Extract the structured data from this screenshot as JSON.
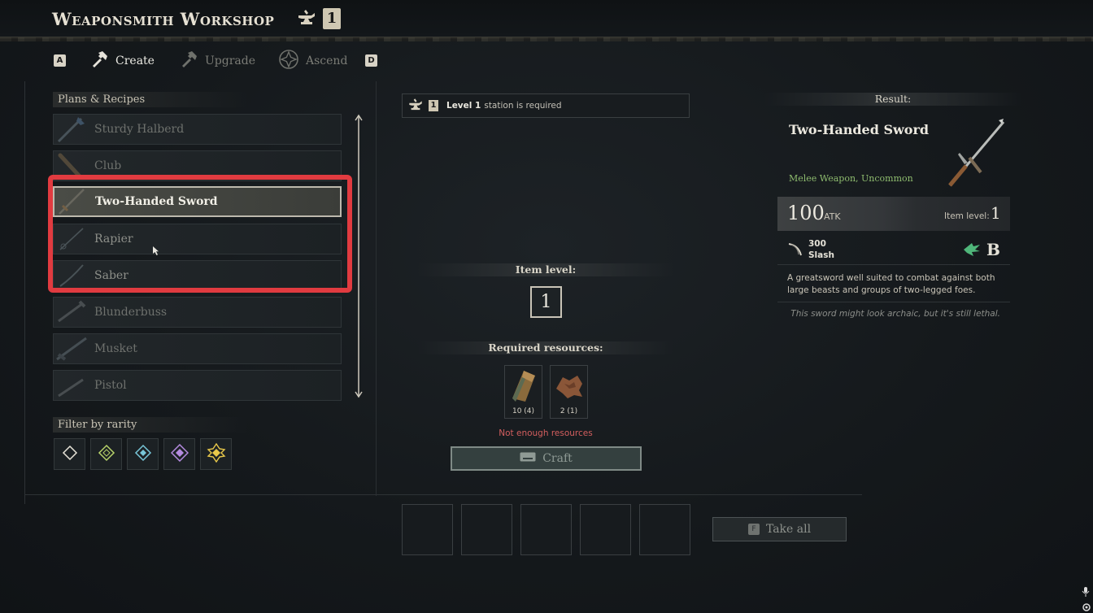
{
  "header": {
    "title": "Weaponsmith Workshop",
    "station_level": "1"
  },
  "tabs": {
    "prev_key": "A",
    "next_key": "D",
    "items": [
      {
        "label": "Create",
        "active": true
      },
      {
        "label": "Upgrade",
        "active": false
      },
      {
        "label": "Ascend",
        "active": false
      }
    ]
  },
  "plans": {
    "label": "Plans & Recipes",
    "items": [
      {
        "name": "Sturdy Halberd"
      },
      {
        "name": "Club"
      },
      {
        "name": "Two-Handed Sword",
        "selected": true
      },
      {
        "name": "Rapier"
      },
      {
        "name": "Saber"
      },
      {
        "name": "Blunderbuss"
      },
      {
        "name": "Musket"
      },
      {
        "name": "Pistol"
      }
    ]
  },
  "filter": {
    "label": "Filter by rarity",
    "colors": [
      "#e8e4d8",
      "#b8d36a",
      "#78c6d8",
      "#b58be0",
      "#e8c84a"
    ]
  },
  "requirement": {
    "level_text": "Level 1",
    "suffix": "station is required",
    "level": "1"
  },
  "crafting": {
    "item_level_label": "Item level:",
    "item_level": "1",
    "resources_label": "Required resources:",
    "resources": [
      {
        "icon": "ingot-icon",
        "count": "10 (4)"
      },
      {
        "icon": "hide-icon",
        "count": "2 (1)"
      }
    ],
    "warning": "Not enough resources",
    "craft_label": "Craft"
  },
  "output": {
    "take_all_label": "Take all",
    "take_all_key": "F"
  },
  "result": {
    "label": "Result:",
    "name": "Two-Handed Sword",
    "type": "Melee Weapon, Uncommon",
    "atk": "100",
    "atk_unit": "ATK",
    "item_level_label": "Item level:",
    "item_level": "1",
    "damage_value": "300",
    "damage_type": "Slash",
    "grade": "B",
    "description": "A greatsword well suited to combat against both large beasts and groups of two-legged foes.",
    "flavor": "This sword might look archaic, but it's still lethal."
  }
}
